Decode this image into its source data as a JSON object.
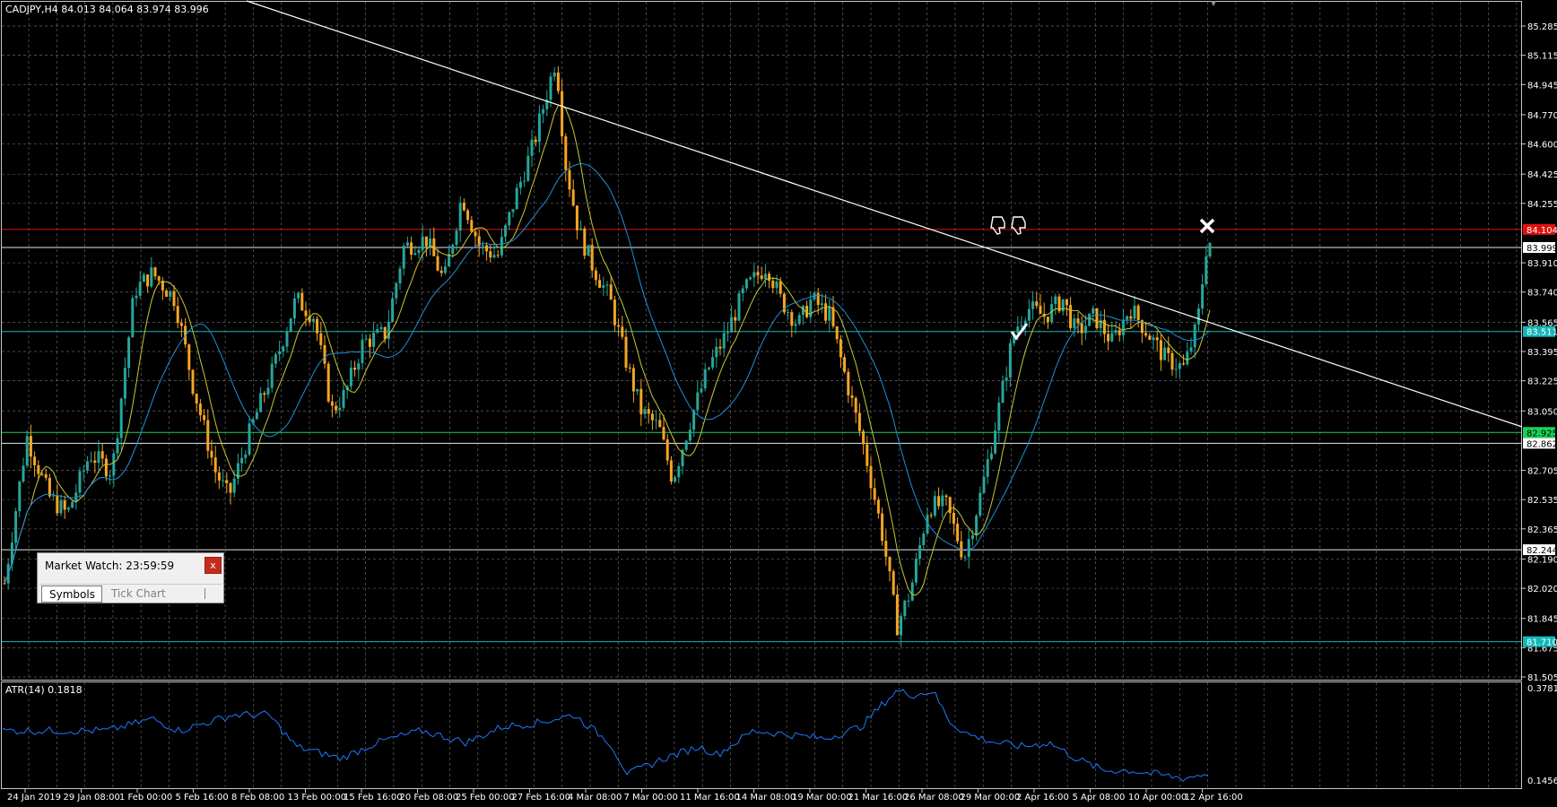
{
  "chart": {
    "header": "CADJPY,H4  84.013 84.064 83.974 83.996",
    "indicator_label": "ATR(14) 0.1818"
  },
  "price_axis": {
    "ticks": [
      "85.285",
      "85.115",
      "84.945",
      "84.770",
      "84.600",
      "84.425",
      "84.255",
      "83.910",
      "83.740",
      "83.565",
      "83.395",
      "83.225",
      "83.050",
      "82.705",
      "82.535",
      "82.365",
      "82.190",
      "82.020",
      "81.845",
      "81.675",
      "81.505"
    ],
    "tags": [
      {
        "label": "84.104",
        "bg": "#e01010",
        "fg": "#ffffff"
      },
      {
        "label": "83.999",
        "bg": "#ffffff",
        "fg": "#000000"
      },
      {
        "label": "83.511",
        "bg": "#13b7b7",
        "fg": "#ffffff"
      },
      {
        "label": "82.925",
        "bg": "#19d25a",
        "fg": "#000000"
      },
      {
        "label": "82.862",
        "bg": "#ffffff",
        "fg": "#000000"
      },
      {
        "label": "82.244",
        "bg": "#ffffff",
        "fg": "#000000"
      },
      {
        "label": "81.710",
        "bg": "#13b7b7",
        "fg": "#ffffff"
      }
    ]
  },
  "atr_axis": {
    "ticks": [
      "0.3781",
      "0.1456"
    ]
  },
  "time_axis": {
    "labels": [
      "24 Jan 2019",
      "29 Jan 08:00",
      "1 Feb 00:00",
      "5 Feb 16:00",
      "8 Feb 08:00",
      "13 Feb 00:00",
      "15 Feb 16:00",
      "20 Feb 08:00",
      "25 Feb 00:00",
      "27 Feb 16:00",
      "4 Mar 08:00",
      "7 Mar 00:00",
      "11 Mar 16:00",
      "14 Mar 08:00",
      "19 Mar 00:00",
      "21 Mar 16:00",
      "26 Mar 08:00",
      "29 Mar 00:00",
      "2 Apr 16:00",
      "5 Apr 08:00",
      "10 Apr 00:00",
      "12 Apr 16:00"
    ]
  },
  "market_watch": {
    "title": "Market Watch: 23:59:59",
    "close_label": "x",
    "tabs": [
      "Symbols",
      "Tick Chart"
    ]
  },
  "colors": {
    "background": "#000000",
    "grid": "#b4b4b4",
    "bull": "#26a69a",
    "bear": "#f5a623",
    "ma_fast": "#c8c832",
    "ma_slow": "#1e90d8",
    "atr": "#1e78ff",
    "resistance": "#e01010",
    "support_cyan": "#13b7b7",
    "support_green": "#19d25a",
    "trendline": "#ffffff"
  },
  "icons": [
    "thumbs-down-icon",
    "thumbs-down-icon",
    "x-mark-icon",
    "check-mark-icon",
    "triangle-marker-icon"
  ]
}
